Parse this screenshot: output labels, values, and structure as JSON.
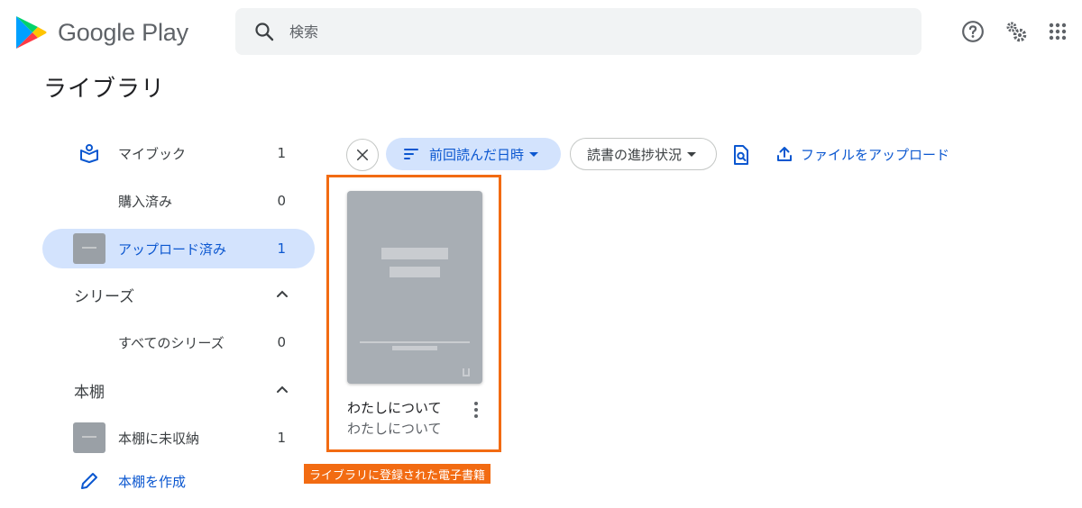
{
  "header": {
    "app_name": "Google Play",
    "search_placeholder": "検索",
    "icons": [
      "help-icon",
      "settings-icon",
      "apps-grid-icon"
    ]
  },
  "page_title": "ライブラリ",
  "sidebar": {
    "my_books": {
      "label": "マイブック",
      "count": "1"
    },
    "purchased": {
      "label": "購入済み",
      "count": "0"
    },
    "uploaded": {
      "label": "アップロード済み",
      "count": "1"
    },
    "series_section": {
      "label": "シリーズ"
    },
    "all_series": {
      "label": "すべてのシリーズ",
      "count": "0"
    },
    "shelves_section": {
      "label": "本棚"
    },
    "unshelved": {
      "label": "本棚に未収納",
      "count": "1"
    },
    "create_shelf": {
      "label": "本棚を作成"
    }
  },
  "toolbar": {
    "sort_label": "前回読んだ日時",
    "progress_label": "読書の進捗状況",
    "upload_label": "ファイルをアップロード"
  },
  "books": [
    {
      "title": "わたしについて",
      "author": "わたしについて"
    }
  ],
  "annotation": "ライブラリに登録された電子書籍",
  "colors": {
    "accent": "#0b57d0",
    "active_bg": "#d3e3fd",
    "highlight": "#f26b12"
  }
}
